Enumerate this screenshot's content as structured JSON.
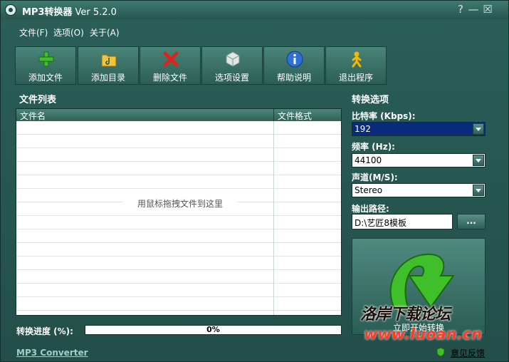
{
  "window": {
    "title": "MP3转换器",
    "version": "Ver 5.2.0",
    "controls": {
      "help": "?",
      "minimize": "—",
      "close": "☒"
    }
  },
  "menu": [
    {
      "label": "文件(F)"
    },
    {
      "label": "选项(O)"
    },
    {
      "label": "关于(A)"
    }
  ],
  "toolbar": [
    {
      "label": "添加文件",
      "icon": "add-file-icon"
    },
    {
      "label": "添加目录",
      "icon": "add-folder-icon"
    },
    {
      "label": "删除文件",
      "icon": "delete-icon"
    },
    {
      "label": "选项设置",
      "icon": "settings-cube-icon"
    },
    {
      "label": "帮助说明",
      "icon": "info-icon"
    },
    {
      "label": "退出程序",
      "icon": "exit-runner-icon"
    }
  ],
  "file_list": {
    "title": "文件列表",
    "columns": [
      "文件名",
      "文件格式"
    ],
    "drop_hint": "用鼠标拖拽文件到这里"
  },
  "options": {
    "title": "转换选项",
    "bitrate_label": "比特率 (Kbps):",
    "bitrate_value": "192",
    "frequency_label": "频率 (Hz):",
    "frequency_value": "44100",
    "channel_label": "声道(M/S):",
    "channel_value": "Stereo",
    "output_label": "输出路径:",
    "output_value": "D:\\艺匠8模板",
    "browse_label": "...",
    "start_label": "立即开始转换"
  },
  "progress": {
    "label": "转换进度 (%):",
    "value": 0,
    "text": "0%"
  },
  "footer": {
    "left": "MP3 Converter",
    "right": "意见反馈"
  },
  "watermark": {
    "line1": "洛岸下载论坛",
    "line2": "www.luoan.cn"
  },
  "colors": {
    "window_bg": "#2a5f58",
    "accent_green": "#3fbf2a",
    "delete_red": "#d8261e",
    "info_blue": "#2f6fd6",
    "selected_blue": "#0a2a7a"
  }
}
